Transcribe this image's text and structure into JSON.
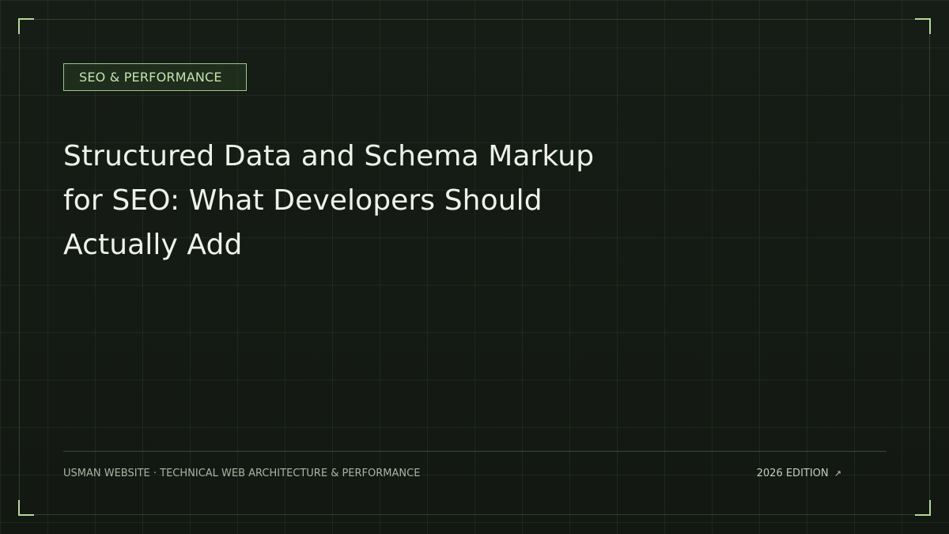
{
  "category": "SEO & PERFORMANCE",
  "title": "Structured Data and Schema Markup for SEO: What Developers Should Actually Add",
  "footer": {
    "site": "USMAN WEBSITE · TECHNICAL WEB ARCHITECTURE & PERFORMANCE",
    "edition": "2026 EDITION",
    "edition_icon": "↗"
  },
  "colors": {
    "background": "#151a15",
    "accent": "#b4d99a",
    "title_text": "#eef2ea",
    "muted_text": "#a9b3a4"
  },
  "icons": {
    "edition_icon": "arrow-up-right-icon"
  }
}
